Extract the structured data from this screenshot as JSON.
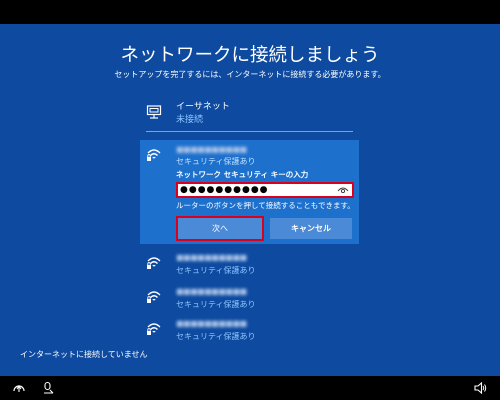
{
  "page": {
    "title": "ネットワークに接続しましょう",
    "subtitle": "セットアップを完了するには、インターネットに接続する必要があります。"
  },
  "ethernet": {
    "name": "イーサネット",
    "status": "未接続",
    "icon": "ethernet-icon"
  },
  "selected_network": {
    "name": "■■■■■■■■■■",
    "security": "セキュリティ保護あり",
    "key_label": "ネットワーク セキュリティ キーの入力",
    "key_value": "●●●●●●●●●●",
    "wps_hint": "ルーターのボタンを押して接続することもできます。",
    "next_label": "次へ",
    "cancel_label": "キャンセル",
    "icon": "wifi-secured-icon"
  },
  "networks": [
    {
      "name": "■■■■■■■■■■",
      "security": "セキュリティ保護あり"
    },
    {
      "name": "■■■■■■■■■■",
      "security": "セキュリティ保護あり"
    },
    {
      "name": "■■■■■■■■■■",
      "security": "セキュリティ保護あり"
    }
  ],
  "footer": {
    "status": "インターネットに接続していません"
  },
  "taskbar": {
    "icons": [
      "accessibility-icon",
      "ime-icon",
      "volume-icon"
    ]
  },
  "colors": {
    "background": "#0d4aa0",
    "selected_panel": "#1e70cd",
    "button": "#4b8ad6",
    "highlight_border": "#d9001e",
    "link_blue": "#8ec5ff"
  }
}
